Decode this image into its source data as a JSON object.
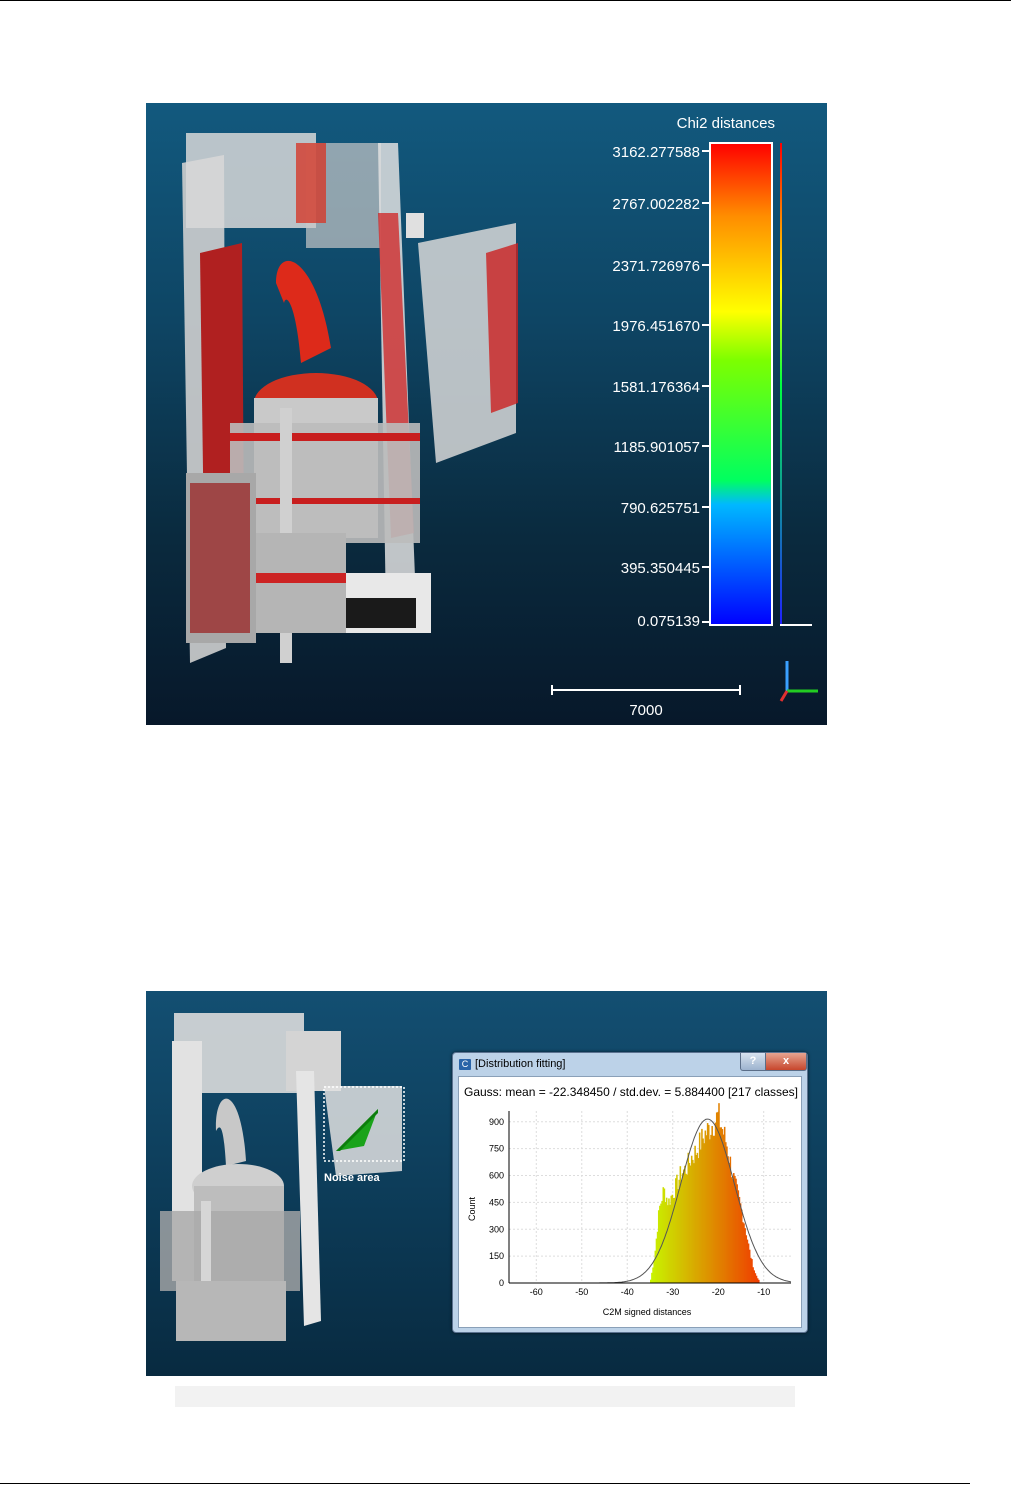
{
  "figure1": {
    "scale_title": "Chi2 distances",
    "scale_ticks": [
      "3162.277588",
      "2767.002282",
      "2371.726976",
      "1976.451670",
      "1581.176364",
      "1185.901057",
      "790.625751",
      "395.350445",
      "0.075139"
    ],
    "scale_bar_label": "7000"
  },
  "figure2": {
    "noise_label": "Noise area",
    "dialog": {
      "title": "[Distribution fitting]",
      "icon_letter": "C",
      "help_button": "?",
      "close_button": "x",
      "header": "Gauss: mean = -22.348450 / std.dev. = 5.884400 [217 classes]"
    }
  },
  "chart_data": {
    "type": "bar",
    "title": "",
    "xlabel": "C2M signed distances",
    "ylabel": "Count",
    "xlim": [
      -66,
      -4
    ],
    "ylim": [
      0,
      960
    ],
    "xticks": [
      "-60",
      "-50",
      "-40",
      "-30",
      "-20",
      "-10"
    ],
    "yticks": [
      "0",
      "150",
      "300",
      "450",
      "600",
      "750",
      "900"
    ],
    "grid": true,
    "histogram_profile": [
      [
        -35,
        0
      ],
      [
        -34,
        150
      ],
      [
        -33,
        410
      ],
      [
        -32,
        520
      ],
      [
        -31,
        450
      ],
      [
        -30,
        500
      ],
      [
        -29,
        560
      ],
      [
        -28,
        620
      ],
      [
        -27,
        640
      ],
      [
        -26,
        700
      ],
      [
        -25,
        730
      ],
      [
        -24,
        780
      ],
      [
        -23,
        830
      ],
      [
        -22,
        860
      ],
      [
        -21,
        900
      ],
      [
        -20,
        930
      ],
      [
        -19,
        850
      ],
      [
        -18,
        760
      ],
      [
        -17,
        620
      ],
      [
        -16,
        520
      ],
      [
        -15,
        420
      ],
      [
        -14,
        300
      ],
      [
        -13,
        160
      ],
      [
        -12,
        60
      ],
      [
        -11,
        10
      ]
    ],
    "gauss_fit": {
      "mean": -22.34845,
      "std": 5.8844,
      "peak": 915
    }
  }
}
